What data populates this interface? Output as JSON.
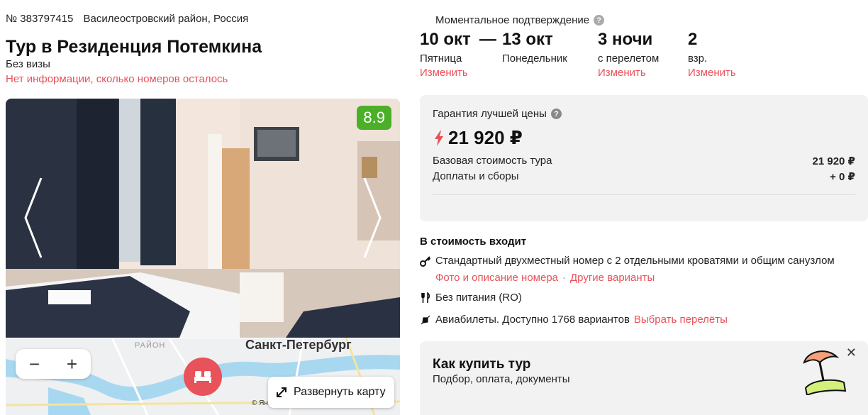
{
  "hotel": {
    "id": "№ 383797415",
    "location": "Василеостровский район, Россия",
    "title": "Тур в Резиденция Потемкина",
    "visa": "Без визы",
    "rooms_info": "Нет информации, сколько номеров осталось",
    "rating": "8.9"
  },
  "map": {
    "city": "Санкт-Петербург",
    "district": "РАЙОН",
    "zoom_out": "−",
    "zoom_in": "+",
    "expand_label": "Развернуть карту",
    "copyright": "© Ян"
  },
  "booking": {
    "instant": "Моментальное подтверждение",
    "date_from": "10 окт",
    "dash": "—",
    "day_from": "Пятница",
    "date_to": "13 окт",
    "day_to": "Понедельник",
    "nights": "3 ночи",
    "nights_sub": "с перелетом",
    "guests": "2",
    "guests_sub": "взр.",
    "change": "Изменить"
  },
  "price": {
    "guarantee": "Гарантия лучшей цены",
    "total": "21 920 ₽",
    "base_label": "Базовая стоимость тура",
    "base_value": "21 920 ₽",
    "fees_label": "Доплаты и сборы",
    "fees_value": "+ 0 ₽"
  },
  "included": {
    "title": "В стоимость входит",
    "room": "Стандартный двухместный номер с 2 отдельными кроватями и общим санузлом",
    "room_photos": "Фото и описание номера",
    "dot": "·",
    "room_other": "Другие варианты",
    "meals": "Без питания (RO)",
    "flights": "Авиабилеты. Доступно 1768 вариантов",
    "flights_link": "Выбрать перелёты"
  },
  "howto": {
    "title": "Как купить тур",
    "subtitle": "Подбор, оплата, документы",
    "close": "✕"
  },
  "colors": {
    "accent": "#e8525a",
    "rating_bg": "#4caf28",
    "panel_bg": "#f2f2f2"
  }
}
